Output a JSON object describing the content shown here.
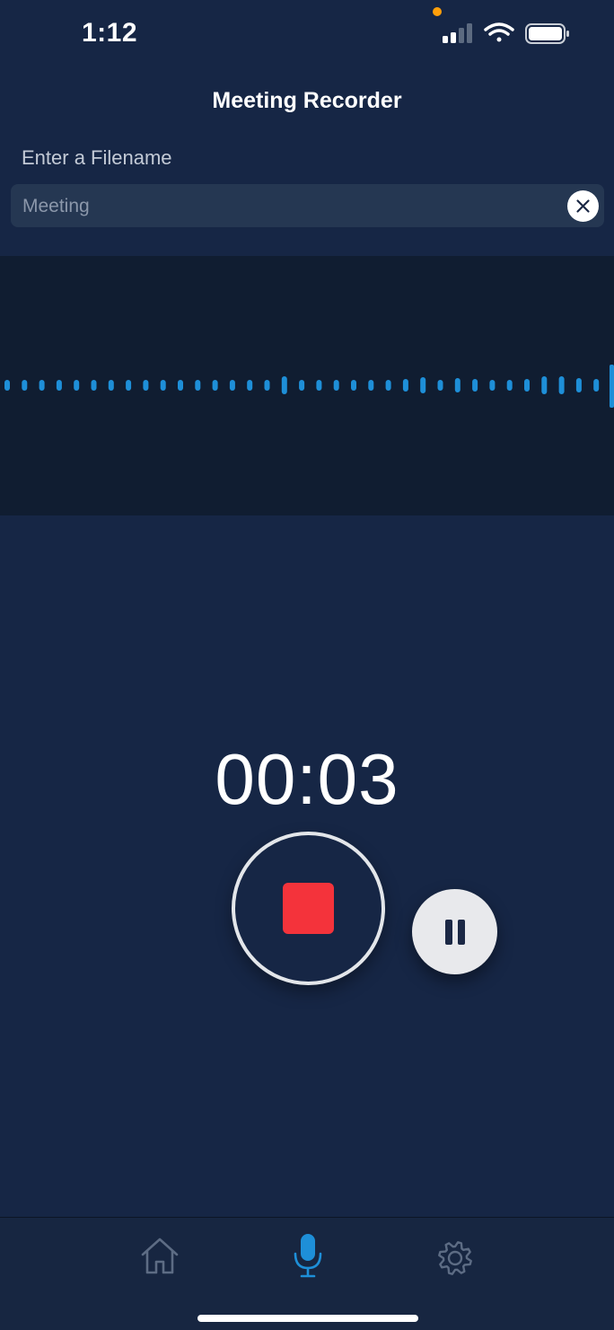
{
  "status_bar": {
    "time": "1:12",
    "icons": [
      "cellular-signal-icon",
      "wifi-icon",
      "battery-icon"
    ],
    "privacy_indicator_color": "#ff9f0a"
  },
  "header": {
    "title": "Meeting Recorder"
  },
  "filename": {
    "label": "Enter a Filename",
    "placeholder": "Meeting",
    "value": "",
    "clear_icon": "close-icon"
  },
  "waveform": {
    "color": "#1e8fd8",
    "playhead_color": "#1e8fd8"
  },
  "recorder": {
    "elapsed": "00:03",
    "stop_icon": "stop-icon",
    "pause_icon": "pause-icon",
    "stop_color": "#f4333b"
  },
  "tab_bar": {
    "tabs": [
      {
        "name": "home",
        "icon": "home-icon",
        "active": false
      },
      {
        "name": "record",
        "icon": "microphone-icon",
        "active": true
      },
      {
        "name": "settings",
        "icon": "gear-icon",
        "active": false
      }
    ],
    "active_color": "#1e8fd8",
    "inactive_color": "#5d6c84"
  },
  "colors": {
    "background": "#162645",
    "panel": "#101d31"
  }
}
